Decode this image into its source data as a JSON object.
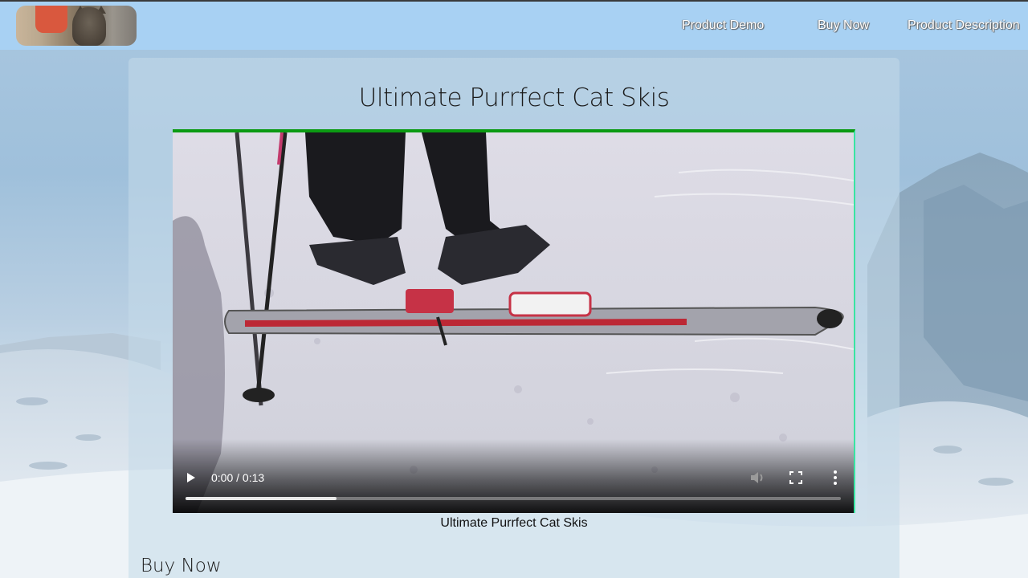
{
  "header": {
    "logo_alt": "cat logo",
    "nav": [
      {
        "label": "Product Demo"
      },
      {
        "label": "Buy Now"
      },
      {
        "label": "Product Description"
      }
    ]
  },
  "main": {
    "title": "Ultimate Purrfect Cat Skis",
    "video": {
      "current_time": "0:00",
      "duration": "0:13",
      "time_display": "0:00 / 0:13",
      "buffered_fraction": 0.23,
      "caption": "Ultimate Purrfect Cat Skis"
    },
    "section_heading": "Buy Now"
  },
  "colors": {
    "header_bg": "#a8d1f3",
    "video_border_top": "#0b9a12",
    "video_border_right": "#39e4a2"
  }
}
